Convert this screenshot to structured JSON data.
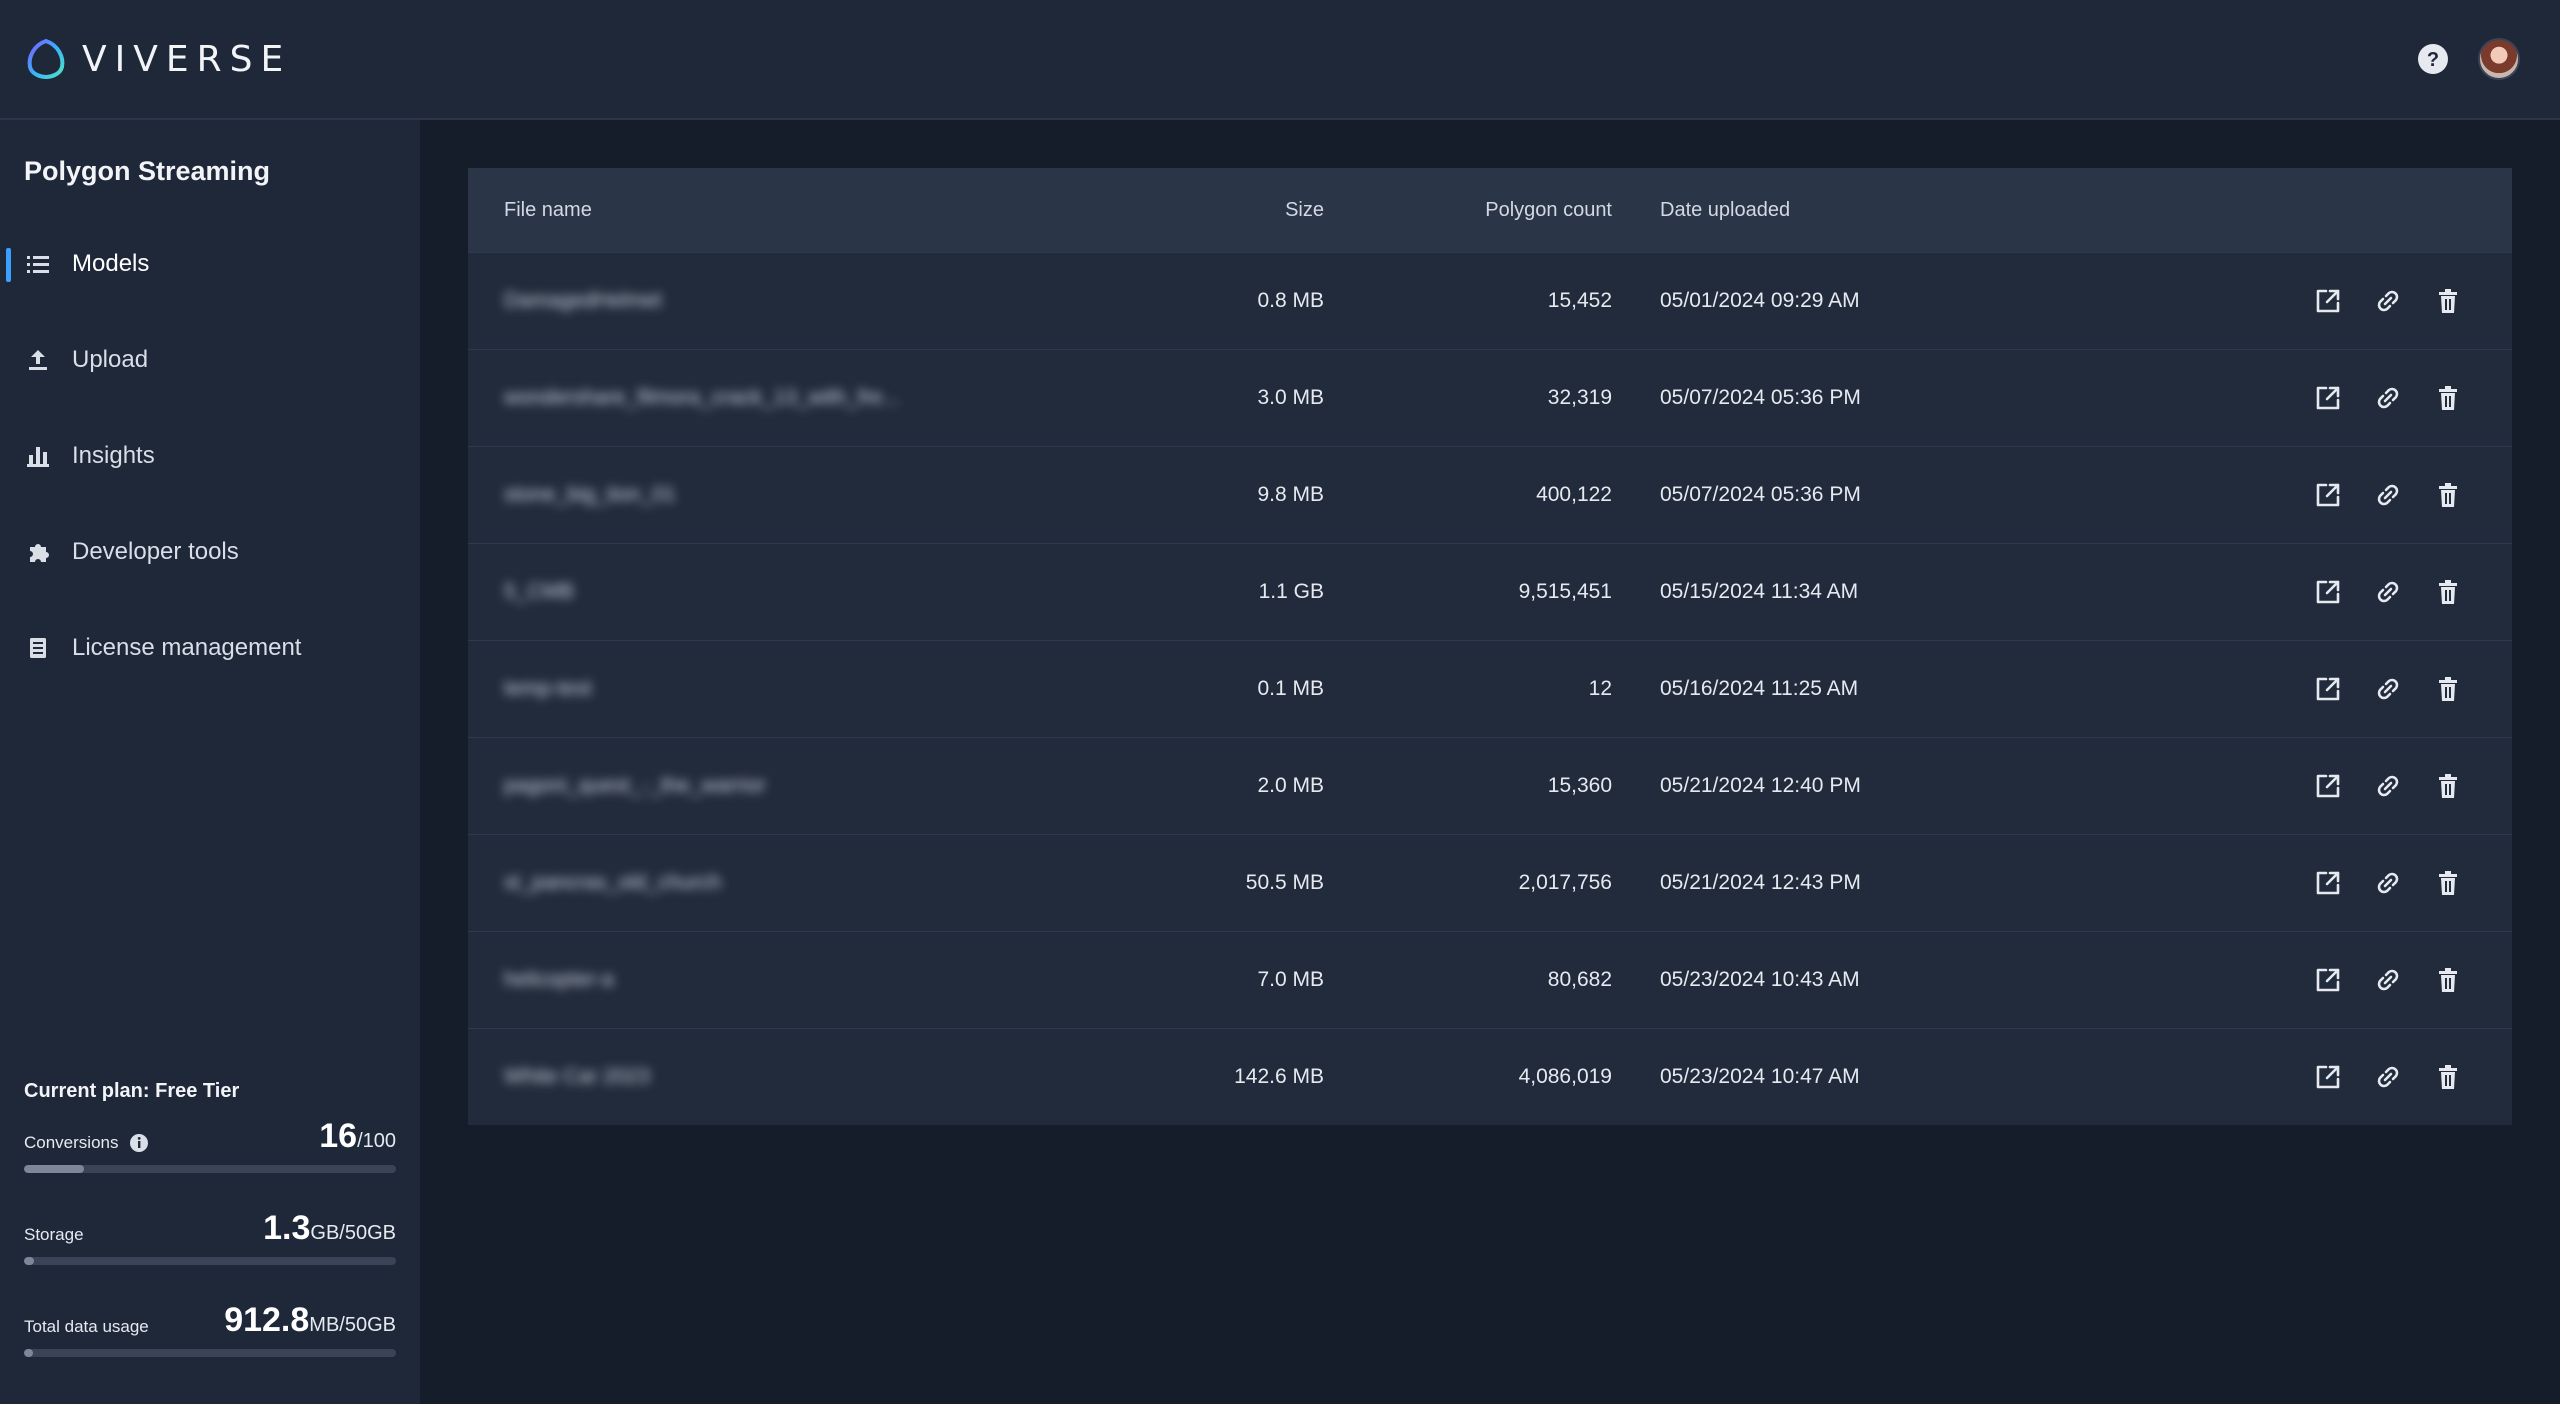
{
  "brand": {
    "name": "VIVERSE"
  },
  "sidebar": {
    "title": "Polygon Streaming",
    "items": [
      {
        "label": "Models",
        "icon": "list-icon",
        "active": true
      },
      {
        "label": "Upload",
        "icon": "upload-icon",
        "active": false
      },
      {
        "label": "Insights",
        "icon": "bar-chart-icon",
        "active": false
      },
      {
        "label": "Developer tools",
        "icon": "puzzle-icon",
        "active": false
      },
      {
        "label": "License management",
        "icon": "document-icon",
        "active": false
      }
    ]
  },
  "usage": {
    "plan": "Current plan: Free Tier",
    "conversions": {
      "label": "Conversions",
      "value": "16",
      "suffix": "/100",
      "fraction": 0.16
    },
    "storage": {
      "label": "Storage",
      "value": "1.3",
      "suffix": "GB/50GB",
      "fraction": 0.026
    },
    "data": {
      "label": "Total data usage",
      "value": "912.8",
      "suffix": "MB/50GB",
      "fraction": 0.018
    }
  },
  "table": {
    "columns": {
      "name": "File name",
      "size": "Size",
      "polygons": "Polygon count",
      "date": "Date uploaded"
    },
    "rows": [
      {
        "name": "DamagedHelmet",
        "size": "0.8 MB",
        "polygons": "15,452",
        "date": "05/01/2024 09:29 AM"
      },
      {
        "name": "wondershare_filmora_crack_13_with_fre...",
        "size": "3.0 MB",
        "polygons": "32,319",
        "date": "05/07/2024 05:36 PM"
      },
      {
        "name": "stone_big_tion_01",
        "size": "9.8 MB",
        "polygons": "400,122",
        "date": "05/07/2024 05:36 PM"
      },
      {
        "name": "5_CMB",
        "size": "1.1 GB",
        "polygons": "9,515,451",
        "date": "05/15/2024 11:34 AM"
      },
      {
        "name": "temp-test",
        "size": "0.1 MB",
        "polygons": "12",
        "date": "05/16/2024 11:25 AM"
      },
      {
        "name": "pagoni_quest_-_the_warrior",
        "size": "2.0 MB",
        "polygons": "15,360",
        "date": "05/21/2024 12:40 PM"
      },
      {
        "name": "st_pancras_old_church",
        "size": "50.5 MB",
        "polygons": "2,017,756",
        "date": "05/21/2024 12:43 PM"
      },
      {
        "name": "helicopter-a",
        "size": "7.0 MB",
        "polygons": "80,682",
        "date": "05/23/2024 10:43 AM"
      },
      {
        "name": "White Car 2023",
        "size": "142.6 MB",
        "polygons": "4,086,019",
        "date": "05/23/2024 10:47 AM"
      }
    ],
    "row_actions": [
      "open-external-icon",
      "link-icon",
      "trash-icon"
    ]
  }
}
